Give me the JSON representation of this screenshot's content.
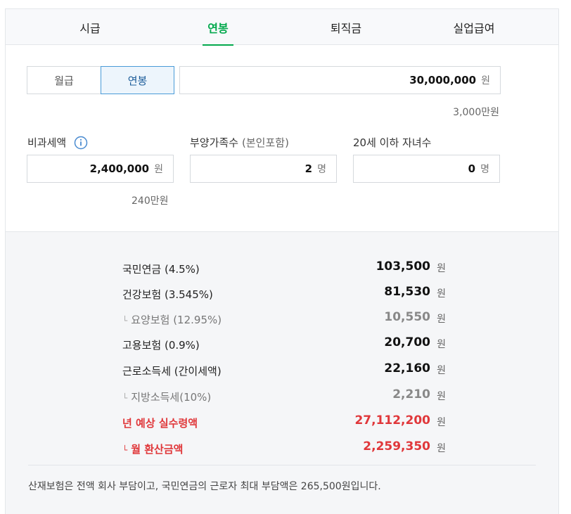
{
  "tabs": [
    {
      "label": "시급"
    },
    {
      "label": "연봉"
    },
    {
      "label": "퇴직금"
    },
    {
      "label": "실업급여"
    }
  ],
  "active_tab": "연봉",
  "pay_type": {
    "monthly_label": "월급",
    "annual_label": "연봉",
    "selected": "연봉"
  },
  "salary": {
    "value": "30,000,000",
    "unit": "원",
    "hint": "3,000만원"
  },
  "nontaxable": {
    "label": "비과세액",
    "icon": "info-icon",
    "value": "2,400,000",
    "unit": "원",
    "hint": "240만원"
  },
  "dependents": {
    "label": "부양가족수",
    "sub_label": "(본인포함)",
    "value": "2",
    "unit": "명"
  },
  "children": {
    "label": "20세 이하 자녀수",
    "value": "0",
    "unit": "명"
  },
  "results": [
    {
      "name": "국민연금 (4.5%)",
      "amount": "103,500",
      "unit": "원"
    },
    {
      "name": "건강보험 (3.545%)",
      "amount": "81,530",
      "unit": "원"
    },
    {
      "name": "요양보험 (12.95%)",
      "amount": "10,550",
      "unit": "원"
    },
    {
      "name": "고용보험 (0.9%)",
      "amount": "20,700",
      "unit": "원"
    },
    {
      "name": "근로소득세 (간이세액)",
      "amount": "22,160",
      "unit": "원"
    },
    {
      "name": "지방소득세(10%)",
      "amount": "2,210",
      "unit": "원"
    },
    {
      "name": "년 예상 실수령액",
      "amount": "27,112,200",
      "unit": "원"
    },
    {
      "name": "월 환산금액",
      "amount": "2,259,350",
      "unit": "원"
    }
  ],
  "sub_marker": "└",
  "note": "산재보험은 전액 회사 부담이고, 국민연금의 근로자 최대 부담액은 265,500원입니다.",
  "colors": {
    "accent_green": "#03a94d",
    "highlight_red": "#e0373a",
    "selected_blue": "#4a9bd8"
  }
}
